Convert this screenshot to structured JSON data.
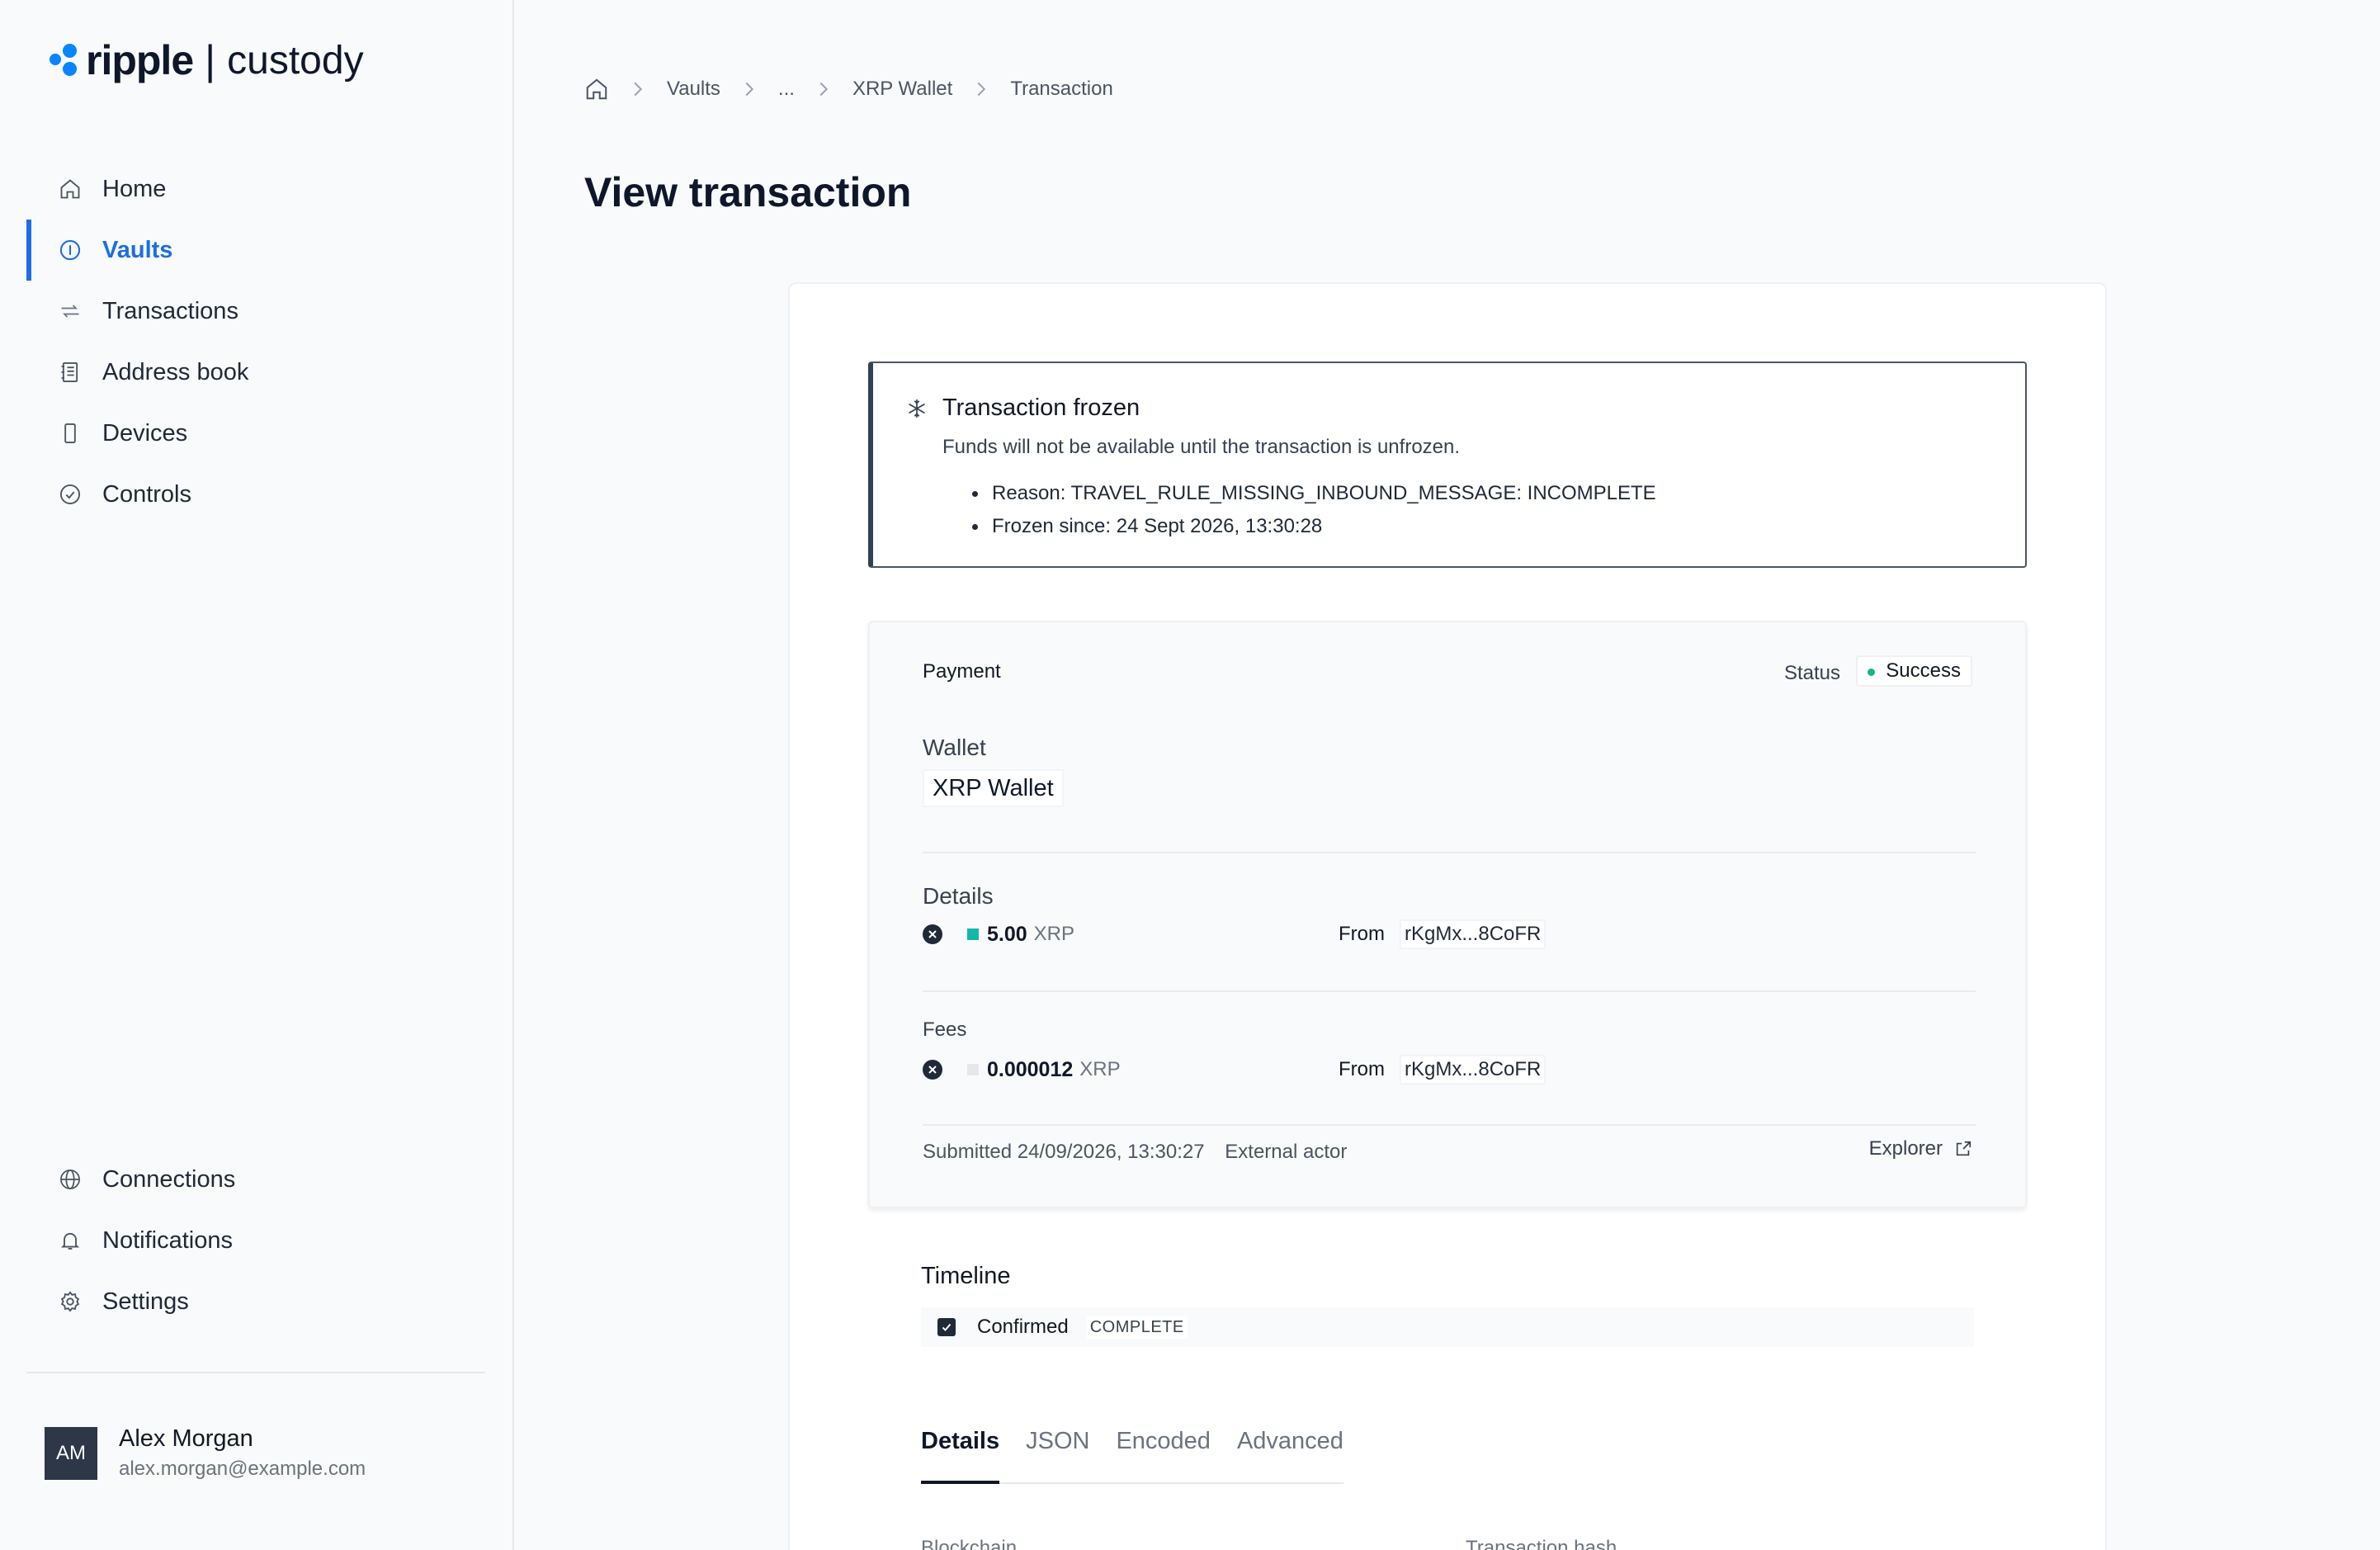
{
  "brand": {
    "name": "ripple",
    "separator": "|",
    "product": "custody",
    "color": "#0a84ff"
  },
  "nav": {
    "items": [
      {
        "label": "Home",
        "icon": "home-icon"
      },
      {
        "label": "Vaults",
        "icon": "vault-icon",
        "active": true
      },
      {
        "label": "Transactions",
        "icon": "transfer-icon"
      },
      {
        "label": "Address book",
        "icon": "address-book-icon"
      },
      {
        "label": "Devices",
        "icon": "device-icon"
      },
      {
        "label": "Controls",
        "icon": "check-circle-icon"
      }
    ],
    "bottom_items": [
      {
        "label": "Connections",
        "icon": "globe-icon"
      },
      {
        "label": "Notifications",
        "icon": "bell-icon"
      },
      {
        "label": "Settings",
        "icon": "gear-icon"
      }
    ]
  },
  "user": {
    "initials": "AM",
    "name": "Alex Morgan",
    "email": "alex.morgan@example.com"
  },
  "breadcrumb": [
    "Vaults",
    "...",
    "XRP Wallet",
    "Transaction"
  ],
  "page_title": "View transaction",
  "alert": {
    "title": "Transaction frozen",
    "description": "Funds will not be available until the transaction is unfrozen.",
    "items": [
      "Reason: TRAVEL_RULE_MISSING_INBOUND_MESSAGE: INCOMPLETE",
      "Frozen since: 24 Sept 2026, 13:30:28"
    ]
  },
  "payment": {
    "type": "Payment",
    "status_label": "Status",
    "status": "Success",
    "status_color": "#10b981",
    "wallet_label": "Wallet",
    "wallet": "XRP Wallet",
    "details_label": "Details",
    "details": {
      "amount": "5.00",
      "unit": "XRP",
      "from_label": "From",
      "from": "rKgMx...8CoFR",
      "token_color": "#14b8a6"
    },
    "fees_label": "Fees",
    "fees": {
      "amount": "0.000012",
      "unit": "XRP",
      "from_label": "From",
      "from": "rKgMx...8CoFR",
      "token_color": "#e5e7eb"
    },
    "submitted": "Submitted 24/09/2026, 13:30:27",
    "actor": "External actor",
    "explorer": "Explorer"
  },
  "timeline": {
    "title": "Timeline",
    "items": [
      {
        "label": "Confirmed",
        "badge": "COMPLETE"
      }
    ]
  },
  "tabs": [
    "Details",
    "JSON",
    "Encoded",
    "Advanced"
  ],
  "active_tab": "Details",
  "details_fields": [
    "Blockchain",
    "Transaction hash"
  ]
}
